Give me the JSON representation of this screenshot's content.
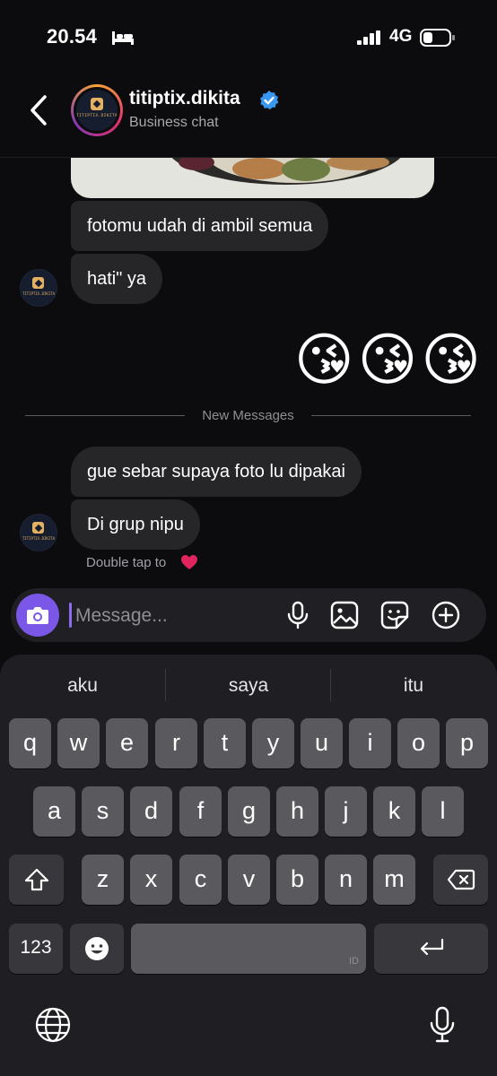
{
  "status_bar": {
    "time": "20.54",
    "network": "4G"
  },
  "header": {
    "name": "titiptix.dikita",
    "subtitle": "Business chat",
    "avatar_text": "TITIPTIX.DIKITA"
  },
  "messages": [
    {
      "text": "fotomu udah di ambil semua"
    },
    {
      "text": "hati\" ya"
    },
    {
      "text": "gue sebar supaya foto lu dipakai"
    },
    {
      "text": "Di grup nipu"
    }
  ],
  "sent_emojis": "😘😘😘",
  "new_messages_label": "New Messages",
  "double_tap_label": "Double tap to",
  "composer": {
    "placeholder": "Message..."
  },
  "keyboard": {
    "suggestions": [
      "aku",
      "saya",
      "itu"
    ],
    "row1": [
      "q",
      "w",
      "e",
      "r",
      "t",
      "y",
      "u",
      "i",
      "o",
      "p"
    ],
    "row2": [
      "a",
      "s",
      "d",
      "f",
      "g",
      "h",
      "j",
      "k",
      "l"
    ],
    "row3": [
      "z",
      "x",
      "c",
      "v",
      "b",
      "n",
      "m"
    ],
    "numbers_label": "123",
    "language_label": "ID"
  },
  "colors": {
    "accent": "#7a57e6",
    "bubble": "#262629",
    "background": "#0c0c0e",
    "verified": "#3897f0",
    "heart": "#e0245e"
  }
}
